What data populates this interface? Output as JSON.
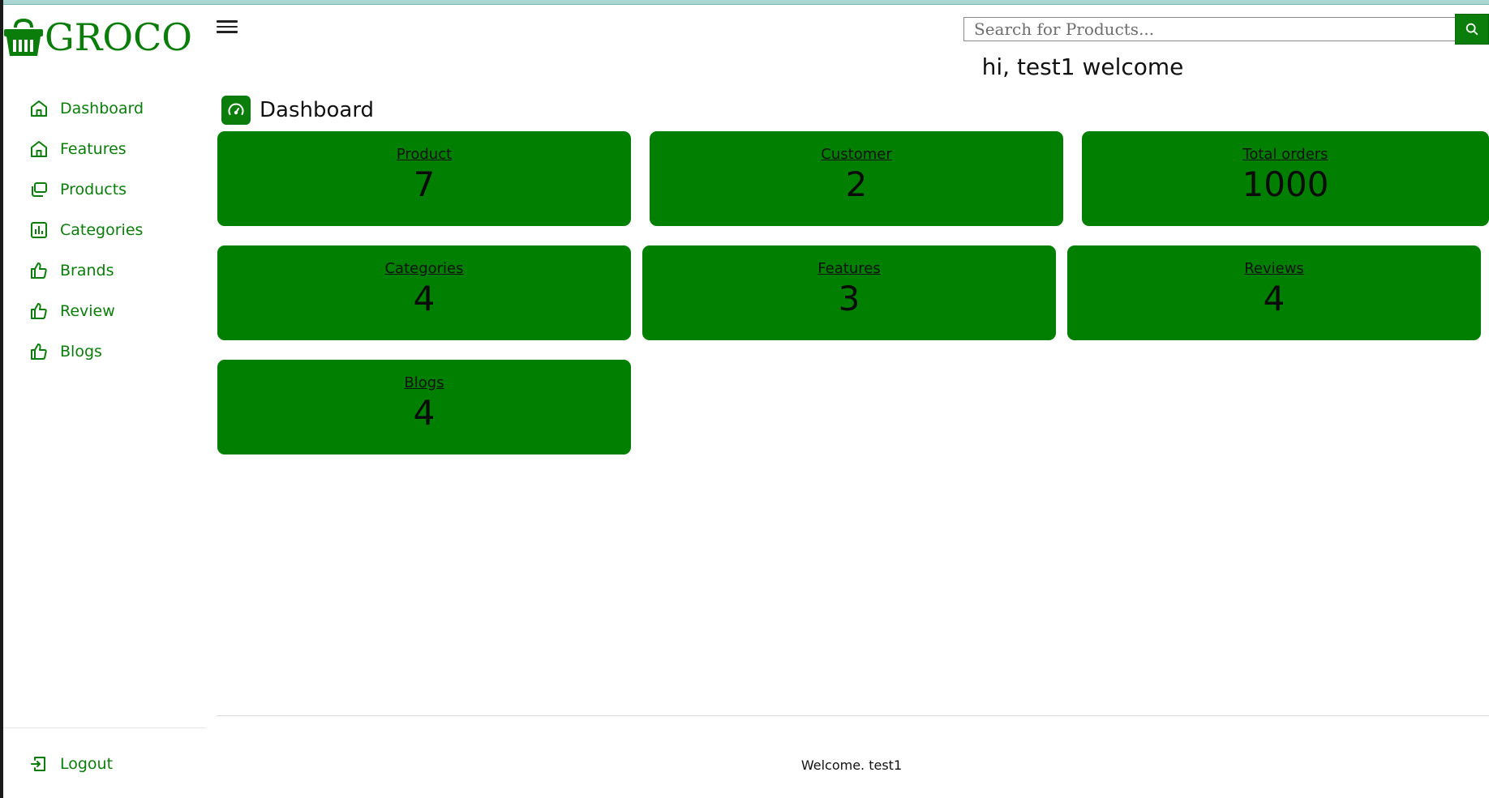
{
  "app": {
    "logo_text": "GROCO"
  },
  "colors": {
    "brand": "#0a7d0a",
    "card": "#007f00"
  },
  "sidebar": {
    "items": [
      {
        "label": "Dashboard",
        "icon": "home-icon"
      },
      {
        "label": "Features",
        "icon": "home-icon"
      },
      {
        "label": "Products",
        "icon": "layers-icon"
      },
      {
        "label": "Categories",
        "icon": "bar-chart-icon"
      },
      {
        "label": "Brands",
        "icon": "thumbs-up-icon"
      },
      {
        "label": "Review",
        "icon": "thumbs-up-icon"
      },
      {
        "label": "Blogs",
        "icon": "thumbs-up-icon"
      }
    ],
    "logout": {
      "label": "Logout",
      "icon": "logout-icon"
    }
  },
  "header": {
    "search_placeholder": "Search for Products...",
    "search_button_icon": "search-icon",
    "menu_icon": "hamburger-icon",
    "welcome": "hi, test1 welcome"
  },
  "page": {
    "title": "Dashboard",
    "title_icon": "speedometer-icon"
  },
  "cards": [
    {
      "label": "Product",
      "value": "7"
    },
    {
      "label": "Customer",
      "value": "2"
    },
    {
      "label": "Total orders",
      "value": "1000"
    },
    {
      "label": "Categories",
      "value": "4"
    },
    {
      "label": "Features",
      "value": "3"
    },
    {
      "label": "Reviews",
      "value": "4"
    },
    {
      "label": "Blogs",
      "value": "4"
    }
  ],
  "footer": {
    "text": "Welcome. test1"
  }
}
